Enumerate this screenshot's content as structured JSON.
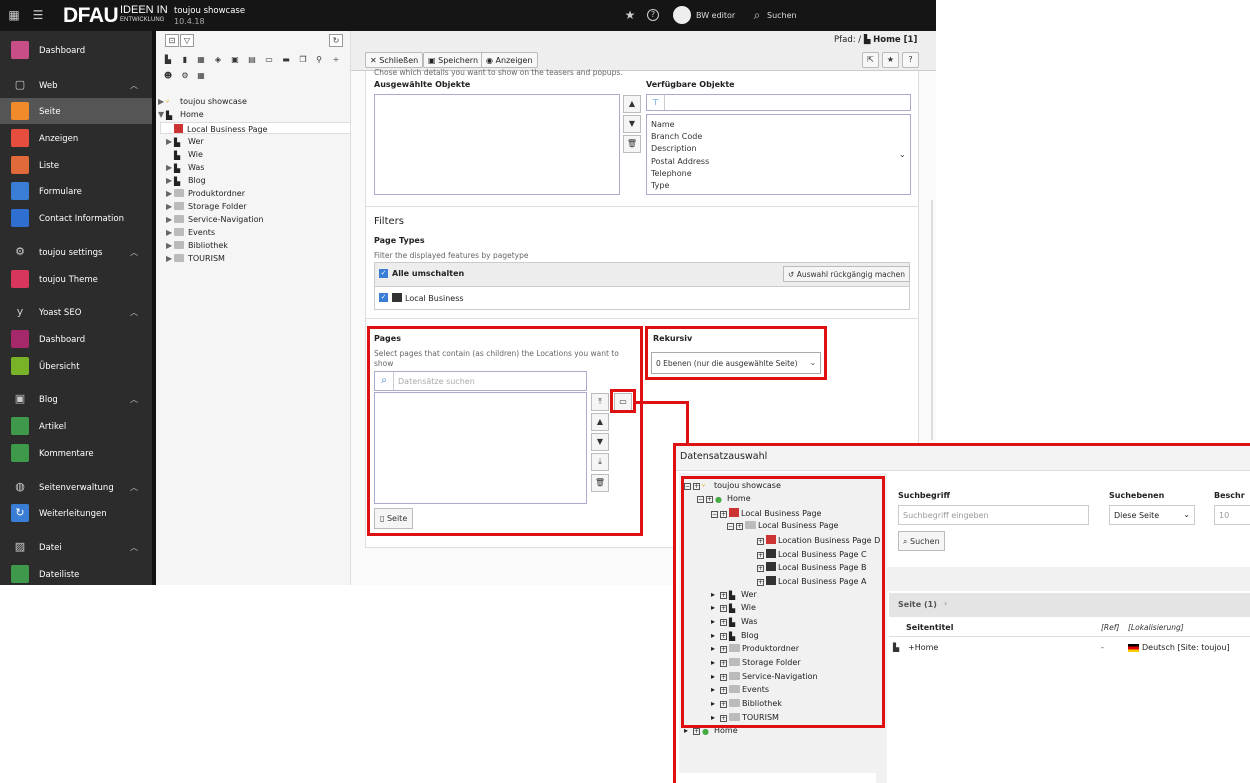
{
  "topbar": {
    "logo": "DFAU",
    "logo_tagline_1": "IDEEN IN",
    "logo_tagline_2": "ENTWICKLUNG",
    "site_name": "toujou showcase",
    "version": "10.4.18",
    "user": "BW editor",
    "search": "Suchen"
  },
  "sidebar": {
    "dashboard": "Dashboard",
    "web": "Web",
    "seite": "Seite",
    "anzeigen": "Anzeigen",
    "liste": "Liste",
    "formulare": "Formulare",
    "contact": "Contact Information",
    "toujou_settings": "toujou settings",
    "toujou_theme": "toujou Theme",
    "yoast": "Yoast SEO",
    "yoast_dashboard": "Dashboard",
    "uebersicht": "Übersicht",
    "blog": "Blog",
    "artikel": "Artikel",
    "kommentare": "Kommentare",
    "seitenverwaltung": "Seitenverwaltung",
    "weiterleitungen": "Weiterleitungen",
    "datei": "Datei",
    "dateiliste": "Dateiliste"
  },
  "pagetree": {
    "root": "toujou showcase",
    "home": "Home",
    "items": [
      "Local Business Page",
      "Wer",
      "Wie",
      "Was",
      "Blog",
      "Produktordner",
      "Storage Folder",
      "Service-Navigation",
      "Events",
      "Bibliothek",
      "TOURISM"
    ]
  },
  "docheader": {
    "close": "Schließen",
    "save": "Speichern",
    "view": "Anzeigen",
    "path_label": "Pfad: /",
    "path_page": "Home [1]"
  },
  "form": {
    "intro": "Chose which details you want to show on the teasers and popups.",
    "selected_label": "Ausgewählte Objekte",
    "available_label": "Verfügbare Objekte",
    "available_items": [
      "Name",
      "Branch Code",
      "Description",
      "Postal Address",
      "Telephone",
      "Type"
    ],
    "filters": "Filters",
    "page_types": "Page Types",
    "page_types_desc": "Filter the displayed features by pagetype",
    "toggle_all": "Alle umschalten",
    "undo": "Auswahl rückgängig machen",
    "local_business": "Local Business",
    "pages": "Pages",
    "pages_desc_1": "Select pages that contain (as children) the Locations you want to",
    "pages_desc_2": "show",
    "search_placeholder": "Datensätze suchen",
    "page_button": "Seite",
    "rekursiv": "Rekursiv",
    "rekursiv_value": "0 Ebenen (nur die ausgewählte Seite)"
  },
  "dialog": {
    "title": "Datensatzauswahl",
    "tree_root": "toujou showcase",
    "tree_home": "Home",
    "tree_lbp": "Local Business Page",
    "tree_lbp2": "Local Business Page",
    "tree_location": "Location Business Page D",
    "tree_c": "Local Business Page C",
    "tree_b": "Local Business Page B",
    "tree_a": "Local Business Page A",
    "tree_items": [
      "Wer",
      "Wie",
      "Was",
      "Blog",
      "Produktordner",
      "Storage Folder",
      "Service-Navigation",
      "Events",
      "Bibliothek",
      "TOURISM"
    ],
    "tree_home2": "Home",
    "search_term_label": "Suchbegriff",
    "search_term_placeholder": "Suchbegriff eingeben",
    "levels_label": "Suchebenen",
    "levels_value": "Diese Seite",
    "limit_label": "Beschr",
    "limit_value": "10",
    "search_button": "Suchen",
    "result_header": "Seite (1)",
    "col_title": "Seitentitel",
    "col_ref": "[Ref]",
    "col_loc": "[Lokalisierung]",
    "row_title": "Home",
    "row_ref": "-",
    "row_loc": "Deutsch [Site: toujou]"
  },
  "colors": {
    "highlight": "#dd1111",
    "sidebar_bg": "#2c2c2c"
  }
}
